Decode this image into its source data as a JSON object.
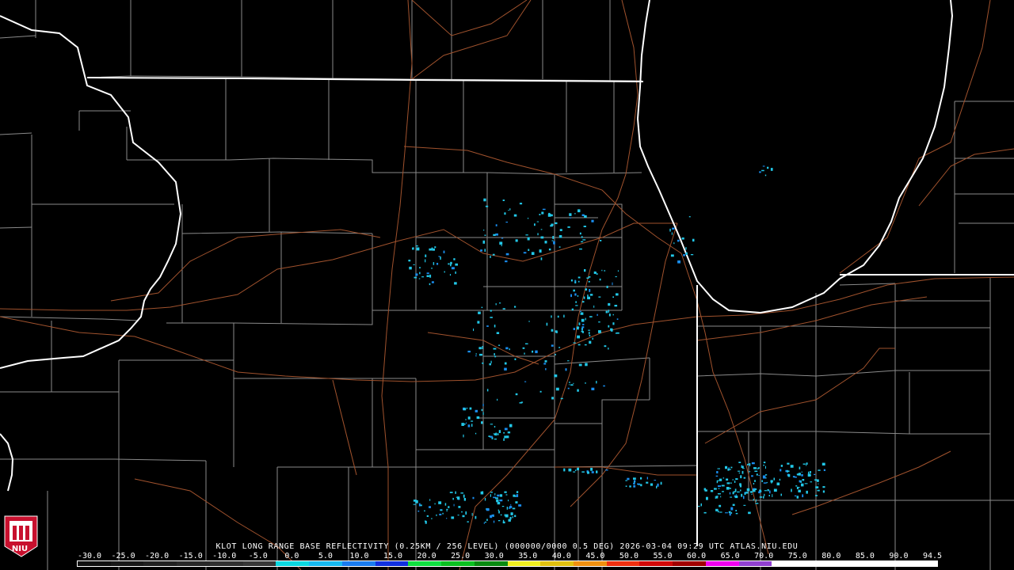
{
  "product": {
    "caption": "KLOT LONG RANGE BASE REFLECTIVITY (0.25KM / 256 LEVEL) (000000/0000 0.5 DEG) 2026-03-04 09:29 UTC  ATLAS.NIU.EDU",
    "radar_site": "KLOT",
    "timestamp": "2026-03-04 09:29 UTC",
    "source": "ATLAS.NIU.EDU"
  },
  "color_scale": {
    "labels": [
      "-30.0",
      "-25.0",
      "-20.0",
      "-15.0",
      "-10.0",
      "-5.0",
      "0.0",
      "5.0",
      "10.0",
      "15.0",
      "20.0",
      "25.0",
      "30.0",
      "35.0",
      "40.0",
      "45.0",
      "50.0",
      "55.0",
      "60.0",
      "65.0",
      "70.0",
      "75.0",
      "80.0",
      "85.0",
      "90.0",
      "94.5"
    ],
    "colors": [
      "#101010",
      "#181818",
      "#202020",
      "#282828",
      "#303030",
      "#383838",
      "#0bd8e0",
      "#15b8f0",
      "#1a7cf0",
      "#1030e0",
      "#0fe040",
      "#0ac020",
      "#088a10",
      "#f0f020",
      "#e0c010",
      "#f09010",
      "#f03010",
      "#d00808",
      "#a00000",
      "#f000f0",
      "#9040d0",
      "#ffffff",
      "#ffffff",
      "#ffffff",
      "#ffffff",
      "#ffffff"
    ]
  },
  "logo": {
    "text": "NIU",
    "color": "#c8102e"
  },
  "map_colors": {
    "state": "#ffffff",
    "county": "#8a8a8a",
    "highway": "#a0522d",
    "echo_light": "#22c8e8",
    "echo_mid": "#1a8ef0"
  }
}
